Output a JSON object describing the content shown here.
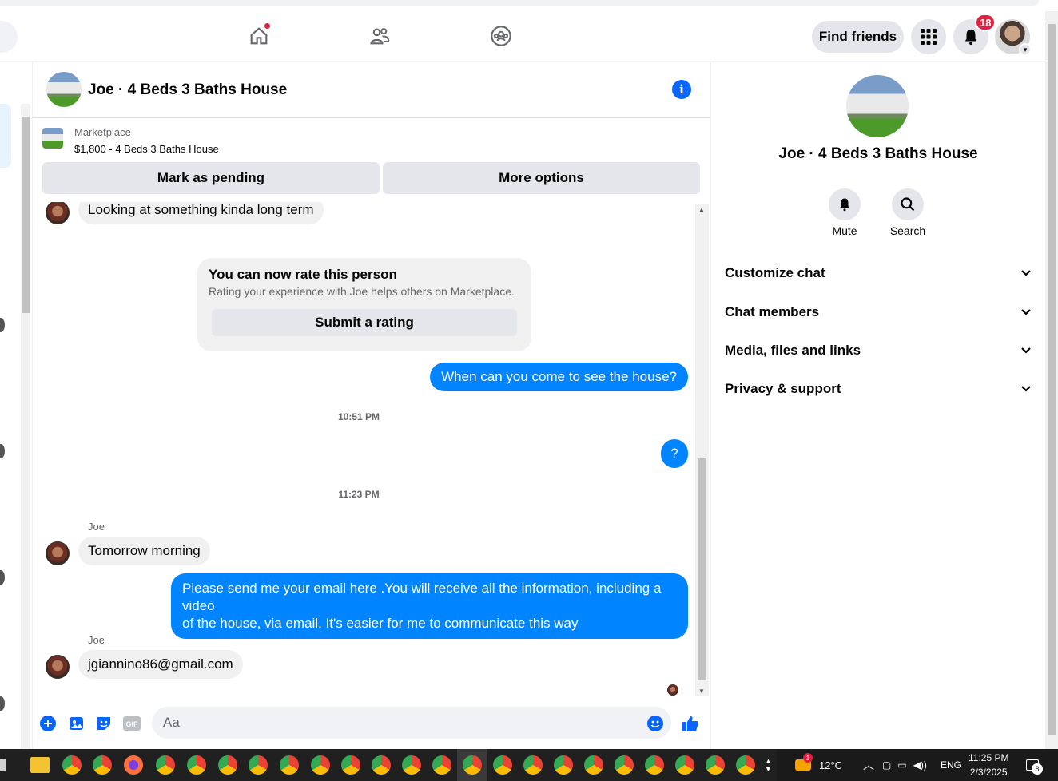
{
  "nav": {
    "find_friends": "Find friends",
    "notif_count": "18"
  },
  "chat": {
    "title": "Joe · 4 Beds 3 Baths House",
    "listing": {
      "source": "Marketplace",
      "price_title": "$1,800 - 4 Beds 3 Baths House",
      "mark_pending": "Mark as pending",
      "more_options": "More options"
    },
    "messages": {
      "m1": "Looking at something kinda long term",
      "rate_title": "You can now rate this person",
      "rate_sub": "Rating your experience with Joe helps others on Marketplace.",
      "rate_btn": "Submit a rating",
      "m2": "When can you come to see the house?",
      "ts1": "10:51 PM",
      "m3": "?",
      "ts2": "11:23 PM",
      "sender1": "Joe",
      "m4": "Tomorrow morning",
      "m5_line1": "Please send me your email here .You will receive all the information, including a video",
      "m5_line2": "of the house, via email. It's easier for me to communicate this way",
      "sender2": "Joe",
      "m6": "jgiannino86@gmail.com"
    },
    "composer": {
      "placeholder": "Aa"
    }
  },
  "panel": {
    "name": "Joe · 4 Beds 3 Baths House",
    "mute": "Mute",
    "search": "Search",
    "sections": [
      "Customize chat",
      "Chat members",
      "Media, files and links",
      "Privacy & support"
    ]
  },
  "taskbar": {
    "weather_badge": "1",
    "temp": "12°C",
    "lang": "ENG",
    "time": "11:25 PM",
    "date": "2/3/2025",
    "notif": "8"
  },
  "colors": {
    "accent": "#0866ff",
    "outgoing_bubble": "#0084ff",
    "badge": "#e41e3f"
  }
}
